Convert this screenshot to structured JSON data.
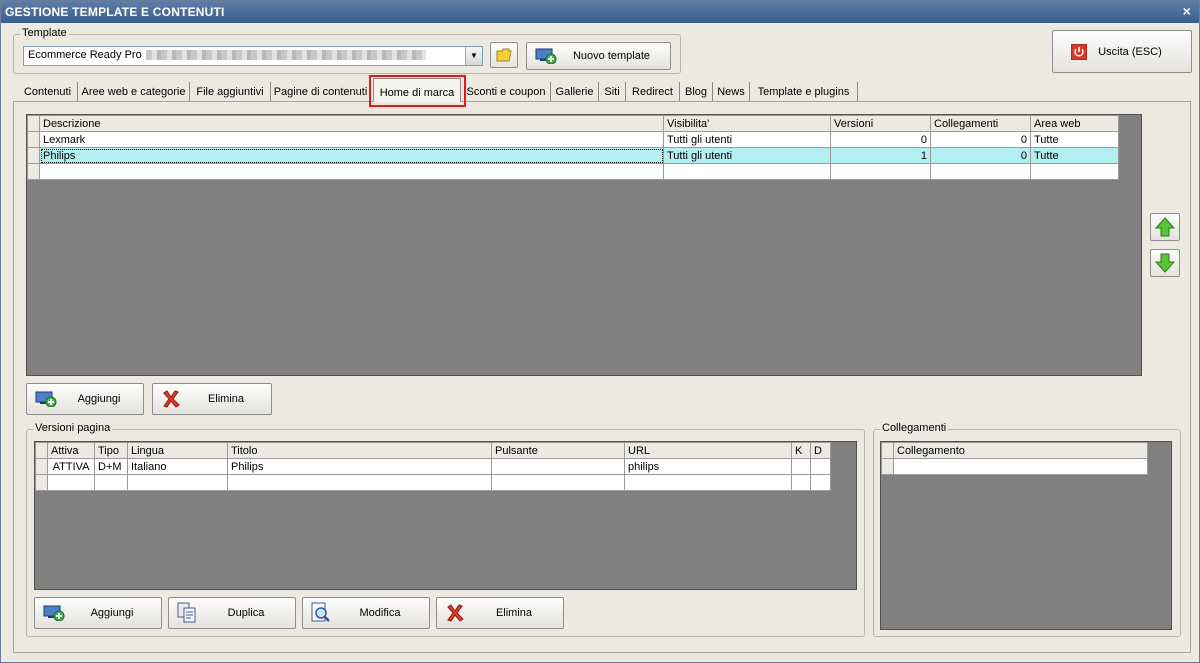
{
  "window": {
    "title": "GESTIONE TEMPLATE E CONTENUTI",
    "close": "×"
  },
  "template_group": {
    "legend": "Template",
    "selected_value": "Ecommerce Ready Pro",
    "new_template_label": "Nuovo template"
  },
  "exit_button": {
    "label": "Uscita (ESC)"
  },
  "tabs": [
    {
      "label": "Contenuti"
    },
    {
      "label": "Aree web e categorie"
    },
    {
      "label": "File aggiuntivi"
    },
    {
      "label": "Pagine di contenuti"
    },
    {
      "label": "Home di marca"
    },
    {
      "label": "Sconti e coupon"
    },
    {
      "label": "Gallerie"
    },
    {
      "label": "Siti"
    },
    {
      "label": "Redirect"
    },
    {
      "label": "Blog"
    },
    {
      "label": "News"
    },
    {
      "label": "Template e plugins"
    }
  ],
  "active_tab": "Home di marca",
  "main_grid": {
    "columns": [
      "Descrizione",
      "Visibilita'",
      "Versioni",
      "Collegamenti",
      "Area web"
    ],
    "rows": [
      {
        "descrizione": "Lexmark",
        "visibilita": "Tutti gli utenti",
        "versioni": "0",
        "collegamenti": "0",
        "area_web": "Tutte"
      },
      {
        "descrizione": "Philips",
        "visibilita": "Tutti gli utenti",
        "versioni": "1",
        "collegamenti": "0",
        "area_web": "Tutte"
      }
    ]
  },
  "main_buttons": {
    "add": "Aggiungi",
    "delete": "Elimina"
  },
  "versions_group": {
    "legend": "Versioni pagina",
    "columns": [
      "Attiva",
      "Tipo",
      "Lingua",
      "Titolo",
      "Pulsante",
      "URL",
      "K",
      "D"
    ],
    "rows": [
      {
        "attiva": "ATTIVA",
        "tipo": "D+M",
        "lingua": "Italiano",
        "titolo": "Philips",
        "pulsante": "",
        "url": "philips",
        "k": "",
        "d": ""
      }
    ],
    "buttons": {
      "add": "Aggiungi",
      "duplicate": "Duplica",
      "edit": "Modifica",
      "delete": "Elimina"
    }
  },
  "links_group": {
    "legend": "Collegamenti",
    "columns": [
      "Collegamento"
    ]
  },
  "colors": {
    "selected_row": "#b3eef0",
    "title_bar": "#3a5d8e",
    "highlight": "#e0191b"
  }
}
